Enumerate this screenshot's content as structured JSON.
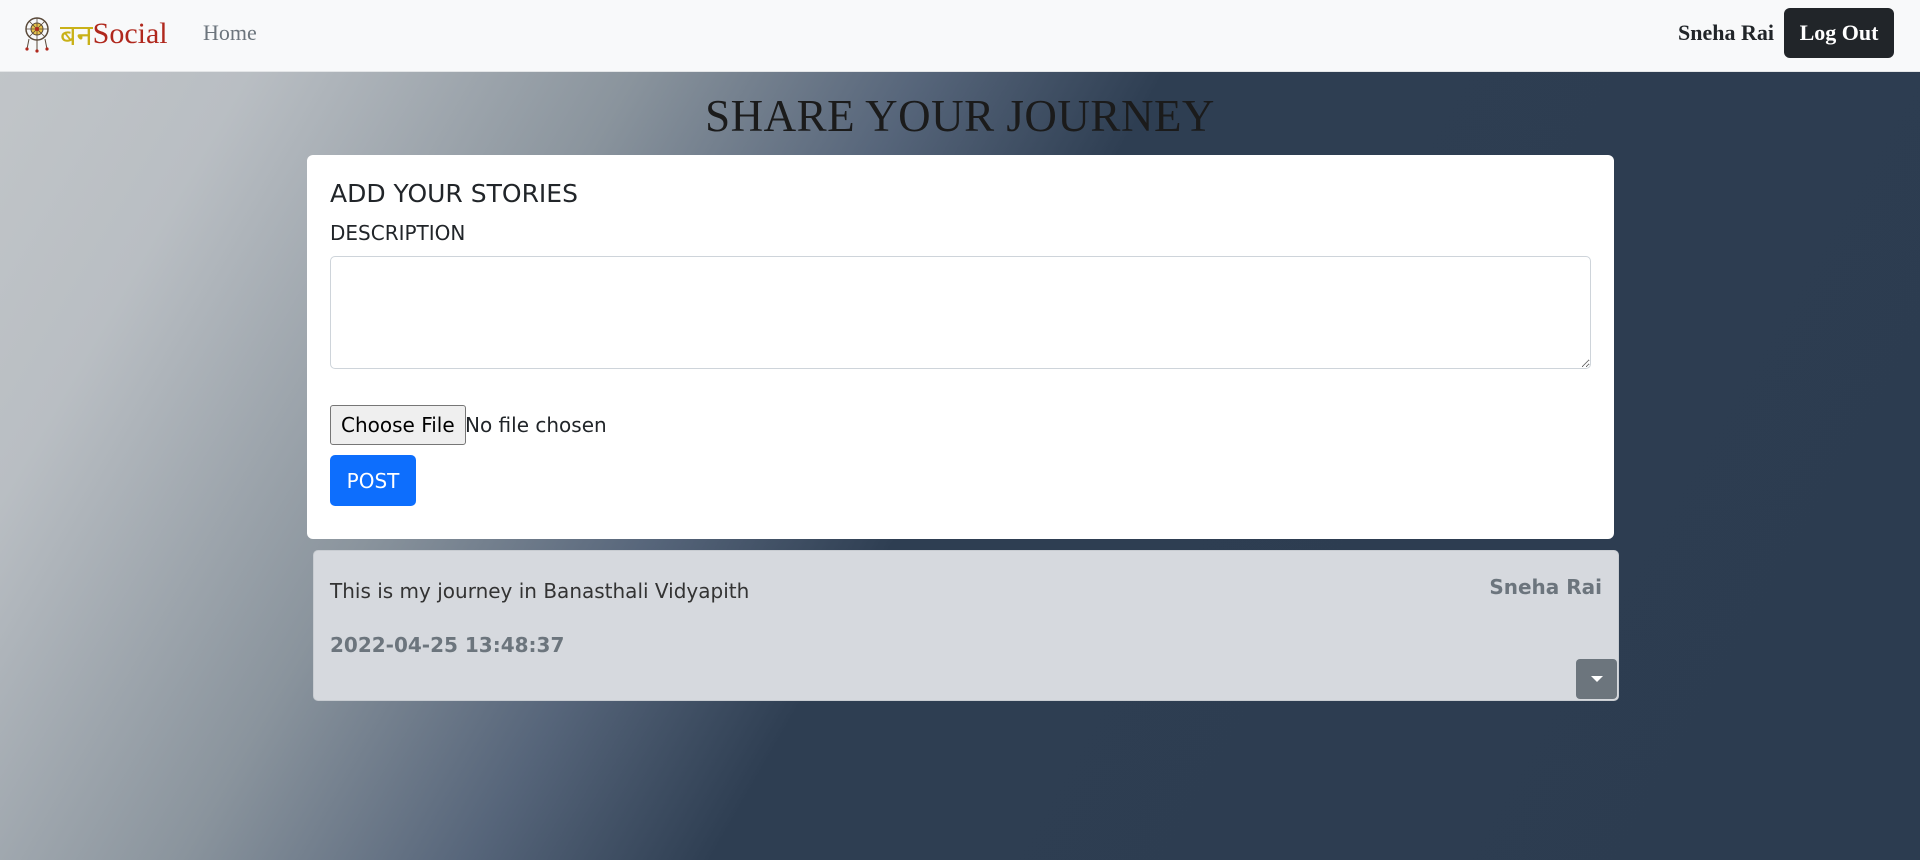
{
  "navbar": {
    "brand_hindi": "बन",
    "brand_english": "Social",
    "home_link": "Home",
    "user_name": "Sneha Rai",
    "logout_label": "Log Out"
  },
  "page": {
    "title": "SHARE YOUR JOURNEY"
  },
  "composer": {
    "title": "ADD YOUR STORIES",
    "description_label": "DESCRIPTION",
    "description_value": "",
    "file_button": "Choose File",
    "file_status": "No file chosen",
    "post_button": "POST"
  },
  "posts": [
    {
      "text": "This is my journey in Banasthali Vidyapith",
      "author": "Sneha Rai",
      "date": "2022-04-25 13:48:37"
    }
  ],
  "colors": {
    "primary": "#0d6efd",
    "dark": "#212529",
    "secondary": "#6c757d",
    "brand_hindi": "#c9b118",
    "brand_english": "#b0281d"
  },
  "icons": {
    "logo": "dreamcatcher-logo-icon",
    "dropdown": "caret-down-icon"
  }
}
